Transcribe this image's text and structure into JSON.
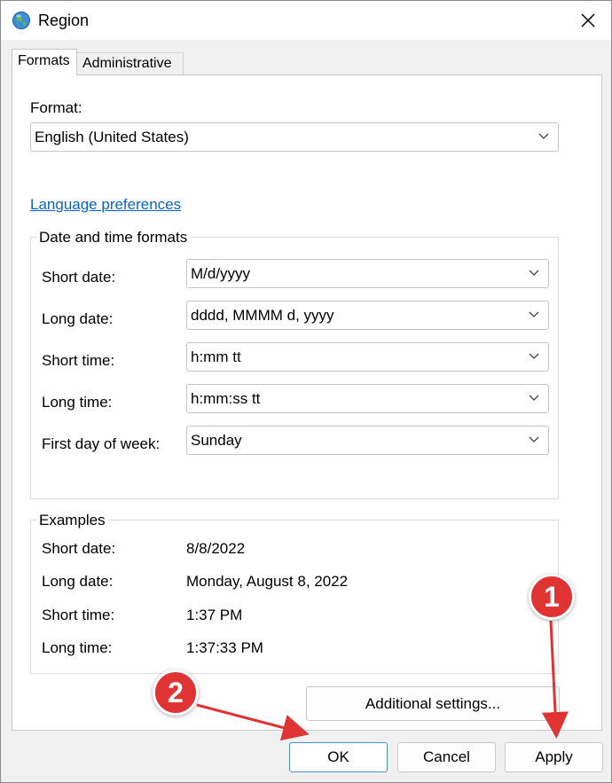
{
  "window": {
    "title": "Region"
  },
  "tabs": [
    {
      "label": "Formats",
      "active": true
    },
    {
      "label": "Administrative",
      "active": false
    }
  ],
  "format": {
    "label": "Format:",
    "value": "English (United States)"
  },
  "language_link": "Language preferences",
  "date_time_formats": {
    "legend": "Date and time formats",
    "rows": [
      {
        "label": "Short date:",
        "value": "M/d/yyyy"
      },
      {
        "label": "Long date:",
        "value": "dddd, MMMM d, yyyy"
      },
      {
        "label": "Short time:",
        "value": "h:mm tt"
      },
      {
        "label": "Long time:",
        "value": "h:mm:ss tt"
      },
      {
        "label": "First day of week:",
        "value": "Sunday"
      }
    ]
  },
  "examples": {
    "legend": "Examples",
    "rows": [
      {
        "label": "Short date:",
        "value": "8/8/2022"
      },
      {
        "label": "Long date:",
        "value": "Monday, August 8, 2022"
      },
      {
        "label": "Short time:",
        "value": "1:37 PM"
      },
      {
        "label": "Long time:",
        "value": "1:37:33 PM"
      }
    ]
  },
  "buttons": {
    "additional_settings": "Additional settings...",
    "ok": "OK",
    "cancel": "Cancel",
    "apply": "Apply"
  },
  "annotations": {
    "step1": "1",
    "step2": "2",
    "color": "#e03434"
  },
  "colors": {
    "link": "#0a64c8",
    "accent_border": "#4a90d9",
    "panel_bg": "#ffffff",
    "dialog_bg": "#f0f0f0"
  }
}
